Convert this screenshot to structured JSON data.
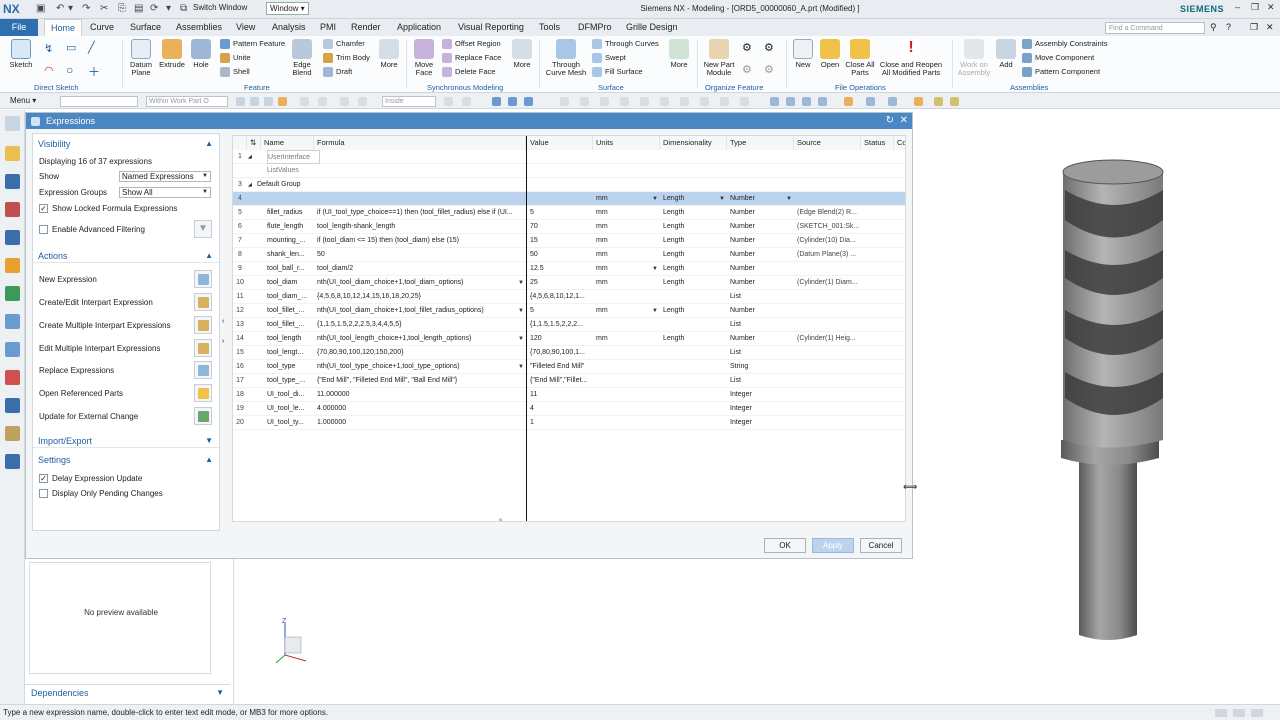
{
  "titlebar": {
    "logo": "NX",
    "switch_window": "Switch Window",
    "window_menu": "Window ▾",
    "app_title": "Siemens NX - Modeling - [ORD5_00000060_A.prt (Modified) ]",
    "brand": "SIEMENS"
  },
  "menu": {
    "file": "File",
    "tabs": [
      "Home",
      "Curve",
      "Surface",
      "Assemblies",
      "View",
      "Analysis",
      "PMI",
      "Render",
      "Application",
      "Visual Reporting",
      "Tools",
      "DFMPro",
      "Grille Design"
    ],
    "find_command_placeholder": "Find a Command"
  },
  "ribbon": {
    "sketch": "Sketch",
    "direct_sketch": "Direct Sketch",
    "datum_plane": "Datum Plane",
    "extrude": "Extrude",
    "hole": "Hole",
    "pattern_feature": "Pattern Feature",
    "unite": "Unite",
    "shell": "Shell",
    "edge_blend": "Edge Blend",
    "chamfer": "Chamfer",
    "trim_body": "Trim Body",
    "draft": "Draft",
    "more1": "More",
    "feature": "Feature",
    "move_face": "Move Face",
    "offset_region": "Offset Region",
    "replace_face": "Replace Face",
    "delete_face": "Delete Face",
    "more2": "More",
    "synchronous_modeling": "Synchronous Modeling",
    "through_curve_mesh": "Through Curve Mesh",
    "through_curves": "Through Curves",
    "swept": "Swept",
    "fill_surface": "Fill Surface",
    "more3": "More",
    "surface": "Surface",
    "new_part_module": "New Part Module",
    "organize_feature": "Organize Feature",
    "new": "New",
    "open": "Open",
    "close_all_parts": "Close All Parts",
    "close_and_reopen": "Close and Reopen All Modified Parts",
    "file_operations": "File Operations",
    "work_on_assembly": "Work on Assembly",
    "add": "Add",
    "assembly_constraints": "Assembly Constraints",
    "move_component": "Move Component",
    "pattern_component": "Pattern Component",
    "assemblies": "Assemblies"
  },
  "selbar": {
    "menu": "Menu ▾",
    "filter_placeholder": "",
    "scope": "Within Work Part O",
    "snap": "Inside"
  },
  "dialog": {
    "title": "Expressions",
    "visibility": "Visibility",
    "displaying": "Displaying 16 of 37 expressions",
    "show_label": "Show",
    "show_value": "Named Expressions",
    "groups_label": "Expression Groups",
    "groups_value": "Show All",
    "show_locked": "Show Locked Formula Expressions",
    "advanced_filtering": "Enable Advanced Filtering",
    "actions": "Actions",
    "action_items": [
      "New Expression",
      "Create/Edit Interpart Expression",
      "Create Multiple Interpart Expressions",
      "Edit Multiple Interpart Expressions",
      "Replace Expressions",
      "Open Referenced Parts",
      "Update for External Change"
    ],
    "import_export": "Import/Export",
    "settings": "Settings",
    "delay_update": "Delay Expression Update",
    "pending_only": "Display Only Pending Changes",
    "ok": "OK",
    "apply": "Apply",
    "cancel": "Cancel"
  },
  "table": {
    "headers": [
      "Name",
      "Formula",
      "Value",
      "Units",
      "Dimensionality",
      "Type",
      "Source",
      "Status",
      "Cor"
    ],
    "rows": [
      {
        "n": "1",
        "name": "UserInterface",
        "formula": "",
        "value": "",
        "units": "",
        "dim": "",
        "type": "",
        "source": ""
      },
      {
        "n": "",
        "name": "ListValues",
        "formula": "",
        "value": "",
        "units": "",
        "dim": "",
        "type": "",
        "source": ""
      },
      {
        "n": "3",
        "name": "Default Group",
        "formula": "",
        "value": "",
        "units": "",
        "dim": "",
        "type": "",
        "source": ""
      },
      {
        "n": "4",
        "name": "",
        "formula": "",
        "value": "",
        "units": "mm",
        "dim": "Length",
        "type": "Number",
        "source": ""
      },
      {
        "n": "5",
        "name": "fillet_radius",
        "formula": "if (UI_tool_type_choice==1) then (tool_fillet_radius) else if (UI...",
        "value": "5",
        "units": "mm",
        "dim": "Length",
        "type": "Number",
        "source": "(Edge Blend(2) R..."
      },
      {
        "n": "6",
        "name": "flute_length",
        "formula": "tool_length-shank_length",
        "value": "70",
        "units": "mm",
        "dim": "Length",
        "type": "Number",
        "source": "(SKETCH_001:Sk..."
      },
      {
        "n": "7",
        "name": "mounting_...",
        "formula": "if (tool_diam <= 15) then (tool_diam) else (15)",
        "value": "15",
        "units": "mm",
        "dim": "Length",
        "type": "Number",
        "source": "(Cylinder(10) Dia..."
      },
      {
        "n": "8",
        "name": "shank_len...",
        "formula": "50",
        "value": "50",
        "units": "mm",
        "dim": "Length",
        "type": "Number",
        "source": "(Datum Plane(3) ..."
      },
      {
        "n": "9",
        "name": "tool_ball_r...",
        "formula": "tool_diam/2",
        "value": "12.5",
        "units": "mm",
        "dim": "Length",
        "type": "Number",
        "source": ""
      },
      {
        "n": "10",
        "name": "tool_diam",
        "formula": "nth(UI_tool_diam_choice+1,tool_diam_options)",
        "value": "25",
        "units": "mm",
        "dim": "Length",
        "type": "Number",
        "source": "(Cylinder(1) Diam..."
      },
      {
        "n": "11",
        "name": "tool_diam_...",
        "formula": "{4,5,6,8,10,12,14,15,16,18,20,25}",
        "value": "{4,5,6,8,10,12,1...",
        "units": "",
        "dim": "",
        "type": "List",
        "source": ""
      },
      {
        "n": "12",
        "name": "tool_fillet_...",
        "formula": "nth(UI_tool_diam_choice+1,tool_fillet_radius_options)",
        "value": "5",
        "units": "mm",
        "dim": "Length",
        "type": "Number",
        "source": ""
      },
      {
        "n": "13",
        "name": "tool_fillet_...",
        "formula": "{1,1.5,1.5,2,2,2.5,3,4,4,5,5}",
        "value": "{1,1.5,1.5,2,2,2...",
        "units": "",
        "dim": "",
        "type": "List",
        "source": ""
      },
      {
        "n": "14",
        "name": "tool_length",
        "formula": "nth(UI_tool_length_choice+1,tool_length_options)",
        "value": "120",
        "units": "mm",
        "dim": "Length",
        "type": "Number",
        "source": "(Cylinder(1) Heig..."
      },
      {
        "n": "15",
        "name": "tool_lengt...",
        "formula": "{70,80,90,100,120,150,200}",
        "value": "{70,80,90,100,1...",
        "units": "",
        "dim": "",
        "type": "List",
        "source": ""
      },
      {
        "n": "16",
        "name": "tool_type",
        "formula": "nth(UI_tool_type_choice+1,tool_type_options)",
        "value": "\"Filleted End Mill\"",
        "units": "",
        "dim": "",
        "type": "String",
        "source": ""
      },
      {
        "n": "17",
        "name": "tool_type_...",
        "formula": "{\"End Mill\", \"Filleted End Mill\", \"Ball End Mill\"}",
        "value": "{\"End Mill\",\"Fillet...",
        "units": "",
        "dim": "",
        "type": "List",
        "source": ""
      },
      {
        "n": "18",
        "name": "UI_tool_di...",
        "formula": "11.000000",
        "value": "11",
        "units": "",
        "dim": "",
        "type": "Integer",
        "source": ""
      },
      {
        "n": "19",
        "name": "UI_tool_le...",
        "formula": "4.000000",
        "value": "4",
        "units": "",
        "dim": "",
        "type": "Integer",
        "source": ""
      },
      {
        "n": "20",
        "name": "UI_tool_ty...",
        "formula": "1.000000",
        "value": "1",
        "units": "",
        "dim": "",
        "type": "Integer",
        "source": ""
      }
    ]
  },
  "preview": {
    "text": "No preview available"
  },
  "dependencies": "Dependencies",
  "status": "Type a new expression name, double-click to enter text edit mode, or MB3 for more options.",
  "colors": {
    "accent": "#2f6fb0",
    "dialog_title": "#4b87c2",
    "selected_row": "#bcd3ee",
    "model": "#8f8f8f"
  }
}
